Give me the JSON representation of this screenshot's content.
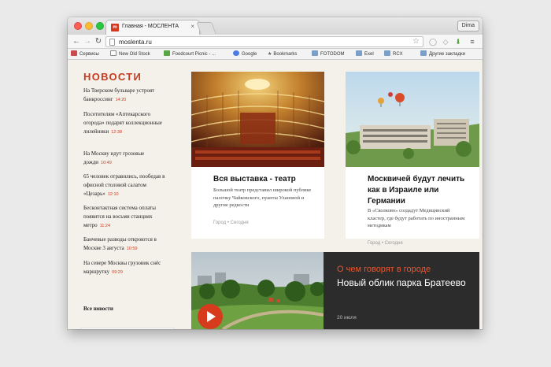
{
  "browser": {
    "tab_title": "Главная - МОСЛЕНТА",
    "tab_favicon_text": "m",
    "profile_name": "Dima",
    "url": "moslenta.ru"
  },
  "bookmarks": [
    {
      "label": "Сервисы",
      "icon": "apps-grid-icon",
      "color": "#c94b4b"
    },
    {
      "label": "New Old Stock",
      "icon": "page-icon",
      "color": "#444"
    },
    {
      "label": "Foodcourt Picnic - ...",
      "icon": "page-icon",
      "color": "#5aa544"
    },
    {
      "label": "Google",
      "icon": "google-icon",
      "color": "#4a7de4"
    },
    {
      "label": "Bookmarks",
      "icon": "star-icon",
      "color": "#555"
    },
    {
      "label": "FOTODOM",
      "icon": "folder-icon",
      "color": "#7aa0c9"
    },
    {
      "label": "Exel",
      "icon": "folder-icon",
      "color": "#7aa0c9"
    },
    {
      "label": "RCX",
      "icon": "folder-icon",
      "color": "#7aa0c9"
    },
    {
      "label": "Другие закладки",
      "icon": "folder-icon",
      "color": "#7aa0c9"
    }
  ],
  "news": {
    "heading": "НОВОСТИ",
    "items": [
      {
        "text": "На Тверском бульваре устроят банкроссинг",
        "time": "14:20"
      },
      {
        "text": "Посетителям «Аптекарского огорода» подарят коллекционные лилейники",
        "time": "12:38"
      },
      {
        "text": "На Москву идут грозовые дожди",
        "time": "10:49"
      },
      {
        "text": "65 человек отравились, пообедав в офисной столовой салатом «Цезарь»",
        "time": "12:10"
      },
      {
        "text": "Бесконтактная система оплаты появится на восьми станциях метро",
        "time": "11:24"
      },
      {
        "text": "Банчевые разводы откроются в Москве 3 августа",
        "time": "10:59"
      },
      {
        "text": "На севере Москвы грузовик снёс маршрутку",
        "time": "09:29"
      }
    ],
    "all_link": "Все новости"
  },
  "cards": [
    {
      "title": "Вся выставка - театр",
      "text": "Большой театр представил широкой публике палочку Чайковского, пуанты Улановой и другие редкости",
      "meta": "Город  •  Сегодня"
    },
    {
      "title": "Москвичей будут лечить как в Израиле или Германии",
      "text": "В «Сколково» создадут Медицинский кластер, где будут работать по иностранным методикам",
      "meta": "Город  •  Сегодня"
    }
  ],
  "feature": {
    "kicker": "О чем говорят в городе",
    "title": "Новый облик парка Братеево",
    "date": "20 июля"
  }
}
